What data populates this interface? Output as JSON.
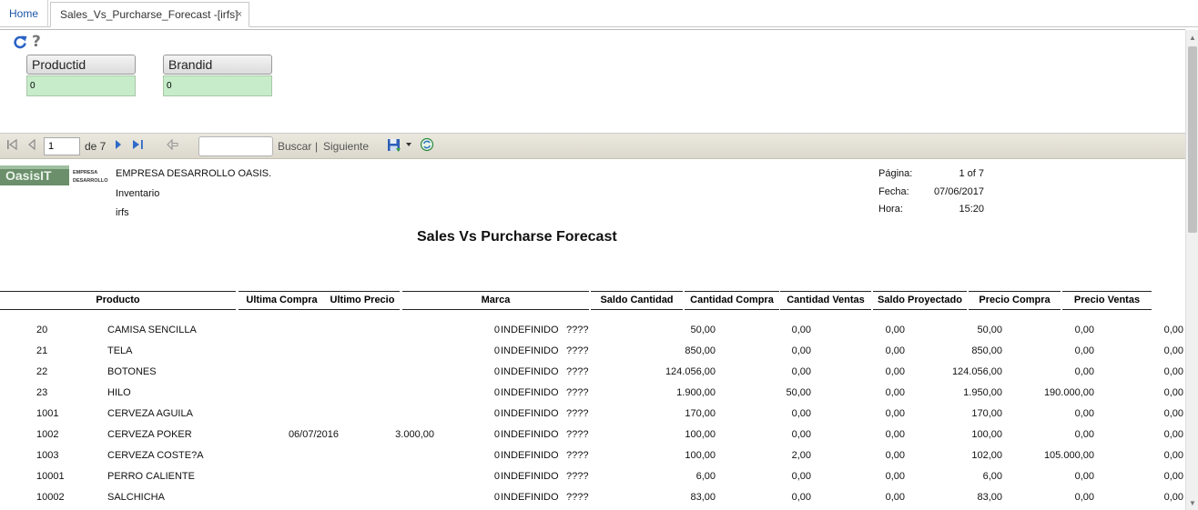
{
  "tabs": {
    "home": "Home",
    "active": "Sales_Vs_Purcharse_Forecast -[irfs]",
    "close": "×"
  },
  "tools": {
    "help": "?"
  },
  "params": [
    {
      "label": "Productid",
      "value": "0"
    },
    {
      "label": "Brandid",
      "value": "0"
    }
  ],
  "toolbar": {
    "page": "1",
    "of_total": "de 7",
    "search_label": "Buscar",
    "separator": "|",
    "next_label": "Siguiente"
  },
  "report": {
    "company": "EMPRESA DESARROLLO OASIS.",
    "module": "Inventario",
    "scheme": "irfs",
    "logo_text": "OasisIT",
    "logo_sub": "EMPRESA DESARROLLO",
    "page_label": "Página:",
    "page_value": "1 of 7",
    "date_label": "Fecha:",
    "date_value": "07/06/2017",
    "time_label": "Hora:",
    "time_value": "15:20",
    "title": "Sales Vs Purcharse Forecast"
  },
  "columns": [
    "Producto",
    "Ultima Compra",
    "Ultimo Precio",
    "Marca",
    "Saldo Cantidad",
    "Cantidad Compra",
    "Cantidad Ventas",
    "Saldo Proyectado",
    "Precio Compra",
    "Precio Ventas"
  ],
  "rows": [
    [
      "20",
      "CAMISA SENCILLA",
      "",
      "",
      "0",
      "INDEFINIDO",
      "????",
      "50,00",
      "0,00",
      "0,00",
      "50,00",
      "0,00",
      "0,00"
    ],
    [
      "21",
      "TELA",
      "",
      "",
      "0",
      "INDEFINIDO",
      "????",
      "850,00",
      "0,00",
      "0,00",
      "850,00",
      "0,00",
      "0,00"
    ],
    [
      "22",
      "BOTONES",
      "",
      "",
      "0",
      "INDEFINIDO",
      "????",
      "124.056,00",
      "0,00",
      "0,00",
      "124.056,00",
      "0,00",
      "0,00"
    ],
    [
      "23",
      "HILO",
      "",
      "",
      "0",
      "INDEFINIDO",
      "????",
      "1.900,00",
      "50,00",
      "0,00",
      "1.950,00",
      "190.000,00",
      "0,00"
    ],
    [
      "1001",
      "CERVEZA AGUILA",
      "",
      "",
      "0",
      "INDEFINIDO",
      "????",
      "170,00",
      "0,00",
      "0,00",
      "170,00",
      "0,00",
      "0,00"
    ],
    [
      "1002",
      "CERVEZA POKER",
      "06/07/2016",
      "3.000,00",
      "0",
      "INDEFINIDO",
      "????",
      "100,00",
      "0,00",
      "0,00",
      "100,00",
      "0,00",
      "0,00"
    ],
    [
      "1003",
      "CERVEZA COSTE?A",
      "",
      "",
      "0",
      "INDEFINIDO",
      "????",
      "100,00",
      "2,00",
      "0,00",
      "102,00",
      "105.000,00",
      "0,00"
    ],
    [
      "10001",
      "PERRO CALIENTE",
      "",
      "",
      "0",
      "INDEFINIDO",
      "????",
      "6,00",
      "0,00",
      "0,00",
      "6,00",
      "0,00",
      "0,00"
    ],
    [
      "10002",
      "SALCHICHA",
      "",
      "",
      "0",
      "INDEFINIDO",
      "????",
      "83,00",
      "0,00",
      "0,00",
      "83,00",
      "0,00",
      "0,00"
    ]
  ]
}
